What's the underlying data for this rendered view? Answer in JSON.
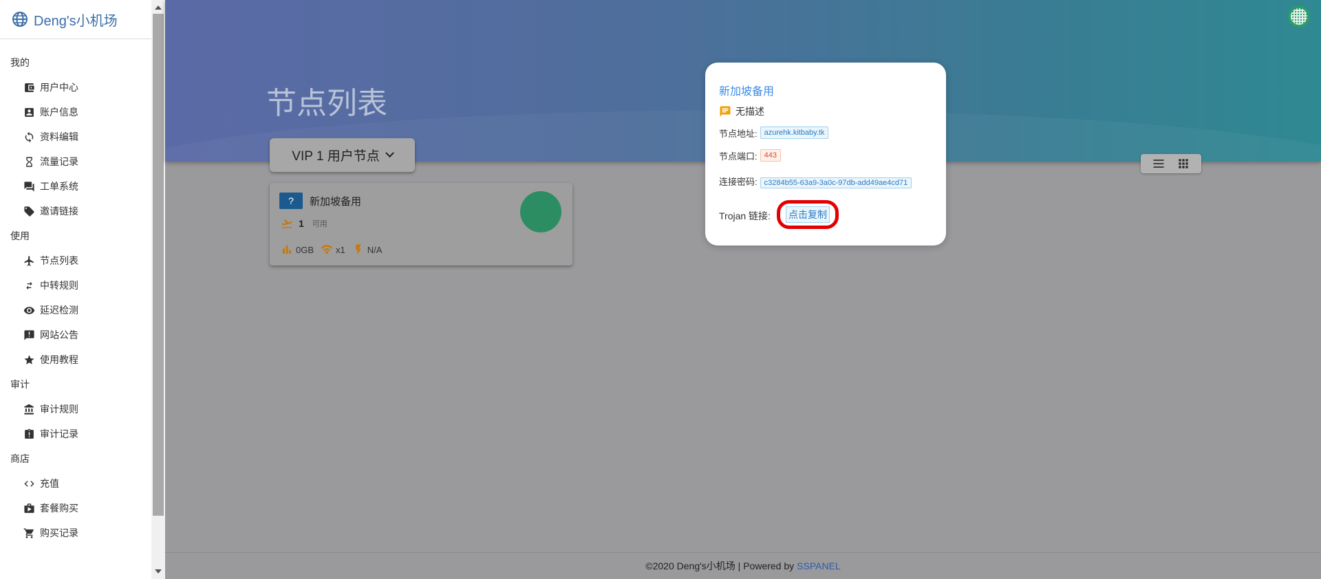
{
  "brand": {
    "name": "Deng's小机场"
  },
  "sidebar": {
    "sections": [
      {
        "title": "我的",
        "items": [
          {
            "label": "用户中心",
            "icon": "wallet-icon"
          },
          {
            "label": "账户信息",
            "icon": "account-box-icon"
          },
          {
            "label": "资料编辑",
            "icon": "sync-icon"
          },
          {
            "label": "流量记录",
            "icon": "hourglass-icon"
          },
          {
            "label": "工单系统",
            "icon": "forum-icon"
          },
          {
            "label": "邀请链接",
            "icon": "tag-icon"
          }
        ]
      },
      {
        "title": "使用",
        "items": [
          {
            "label": "节点列表",
            "icon": "airplane-icon"
          },
          {
            "label": "中转规则",
            "icon": "transfer-icon"
          },
          {
            "label": "延迟检测",
            "icon": "eye-icon"
          },
          {
            "label": "网站公告",
            "icon": "announcement-icon"
          },
          {
            "label": "使用教程",
            "icon": "star-icon"
          }
        ]
      },
      {
        "title": "审计",
        "items": [
          {
            "label": "审计规则",
            "icon": "bank-icon"
          },
          {
            "label": "审计记录",
            "icon": "assignment-icon"
          }
        ]
      },
      {
        "title": "商店",
        "items": [
          {
            "label": "充值",
            "icon": "code-icon"
          },
          {
            "label": "套餐购买",
            "icon": "shop-icon"
          },
          {
            "label": "购买记录",
            "icon": "cart-icon"
          }
        ]
      }
    ]
  },
  "main": {
    "page_title": "节点列表",
    "group_button": "VIP 1 用户节点"
  },
  "node_card": {
    "name": "新加坡备用",
    "flag": "?",
    "online_count": "1",
    "status": "可用",
    "traffic": "0GB",
    "rate": "x1",
    "speed": "N/A"
  },
  "popup": {
    "title": "新加坡备用",
    "description": "无描述",
    "address_label": "节点地址:",
    "address": "azurehk.kitbaby.tk",
    "port_label": "节点端口:",
    "port": "443",
    "password_label": "连接密码:",
    "password": "c3284b55-63a9-3a0c-97db-add49ae4cd71",
    "trojan_label": "Trojan 链接:",
    "copy_label": "点击复制"
  },
  "footer": {
    "text": "©2020 Deng's小机场 | Powered by",
    "link": "SSPANEL"
  },
  "colors": {
    "accent": "#3d8be6",
    "highlight": "#e40000",
    "hero_start": "#5b6aa6",
    "hero_end": "#2f8993"
  }
}
